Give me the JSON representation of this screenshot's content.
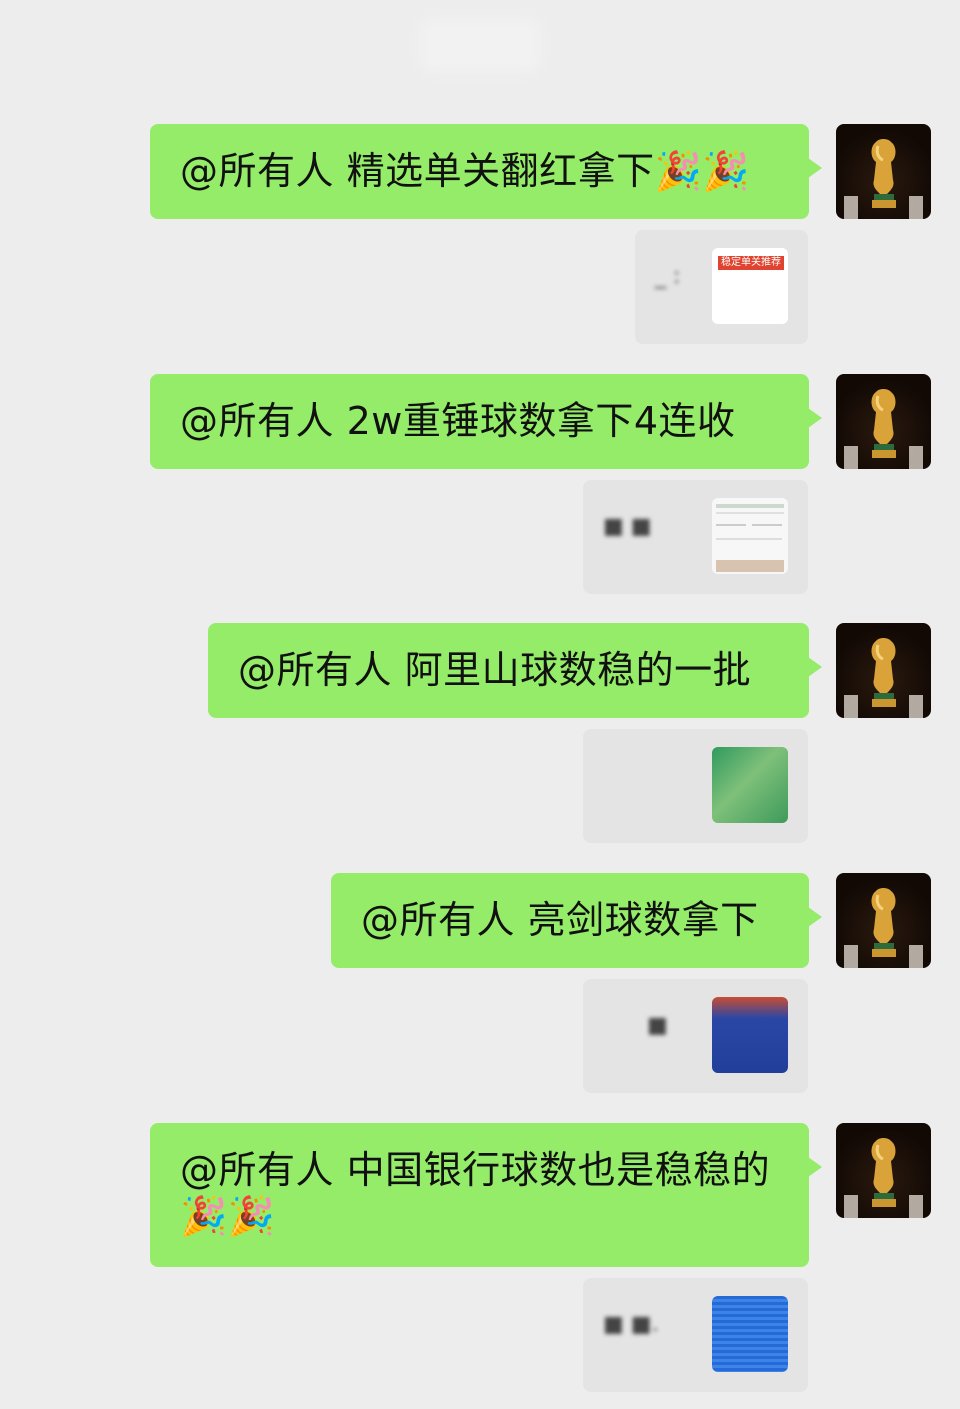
{
  "messages": [
    {
      "text": "@所有人  精选单关翻红拿下🎉🎉",
      "card_text": "_ :",
      "thumb_tag": "稳定单关推荐"
    },
    {
      "text": "@所有人  2w重锤球数拿下4连收",
      "card_text": "■ ■"
    },
    {
      "text": "@所有人  阿里山球数稳的一批",
      "card_text": ""
    },
    {
      "text": "@所有人  亮剑球数拿下",
      "card_text": "■"
    },
    {
      "text": "@所有人  中国银行球数也是稳稳的🎉🎉",
      "card_text": "■ ■."
    }
  ],
  "colors": {
    "background": "#ededed",
    "bubble": "#95ec69",
    "card": "#e4e4e4"
  },
  "icons": {
    "avatar": "world-cup-trophy-icon"
  }
}
